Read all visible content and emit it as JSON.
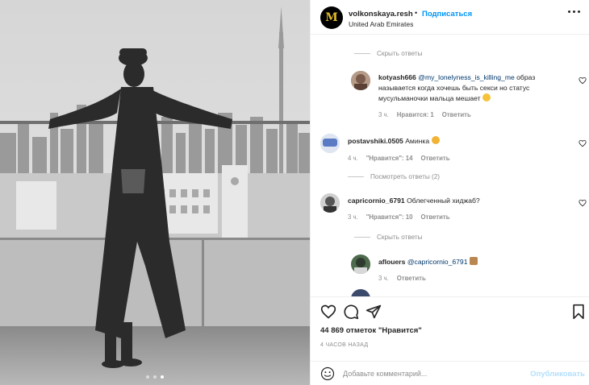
{
  "post": {
    "username": "volkonskaya.reshe",
    "follow_label": "Подписаться",
    "separator": "•",
    "location": "United Arab Emirates",
    "avatar_letter": "M",
    "more_icon": "more-icon"
  },
  "comments_area": {
    "hide_replies_1": "Скрыть ответы",
    "reply_1": {
      "username": "kotyash666",
      "mention": "@my_lonelyness_is_killing_me",
      "text_line1": "образ",
      "text_line2": "называется когда хочешь быть секси но статус",
      "text_line3": "мусульманочки мальца мешает",
      "time": "3 ч.",
      "likes": "Нравится: 1",
      "reply_label": "Ответить"
    },
    "comment_1": {
      "username": "postavshiki.0505",
      "text": "Аминка",
      "time": "4 ч.",
      "likes": "\"Нравится\": 14",
      "reply_label": "Ответить"
    },
    "view_replies": "Посмотреть ответы (2)",
    "comment_2": {
      "username": "capricornio_6791",
      "text": "Облегченный хиджаб?",
      "time": "3 ч.",
      "likes": "\"Нравится\": 10",
      "reply_label": "Ответить"
    },
    "hide_replies_2": "Скрыть ответы",
    "reply_2": {
      "username": "aflouers",
      "mention": "@capricornio_6791",
      "time": "3 ч.",
      "reply_label": "Ответить"
    }
  },
  "likes_text": "44 869 отметок \"Нравится\"",
  "time_ago": "4 ЧАСОВ НАЗАД",
  "add_comment": {
    "placeholder": "Добавьте комментарий...",
    "publish_label": "Опубликовать"
  },
  "carousel": {
    "count": 3,
    "active_index": 3
  },
  "colors": {
    "accent": "#0095f6",
    "mention": "#00376b",
    "muted": "#8e8e8e",
    "publish_disabled": "#b2dffc",
    "brand_gold": "#e2b92a"
  }
}
